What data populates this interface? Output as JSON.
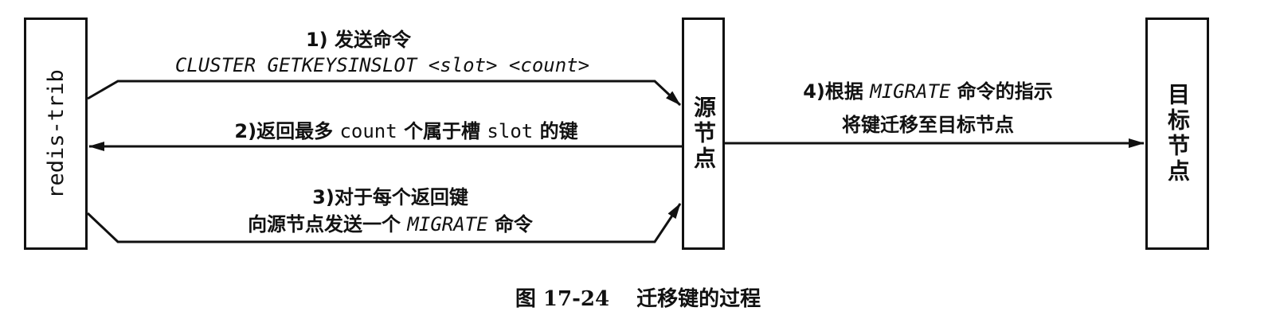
{
  "nodes": {
    "redis_trib": "redis-trib",
    "source": "源节点",
    "target": "目标节点"
  },
  "step1": {
    "title": "1) 发送命令",
    "command": "CLUSTER GETKEYSINSLOT <slot> <count>"
  },
  "step2": {
    "prefix": "2)返回最多",
    "count": "count",
    "middle": "个属于槽",
    "slot": "slot",
    "suffix": "的键"
  },
  "step3": {
    "title": "3)对于每个返回键",
    "prefix": "向源节点发送一个",
    "command": "MIGRATE",
    "suffix": "命令"
  },
  "step4": {
    "prefix": "4)根据",
    "command": "MIGRATE",
    "suffix": "命令的指示",
    "subtitle": "将键迁移至目标节点"
  },
  "caption": {
    "number": "图 17-24",
    "title": "迁移键的过程"
  },
  "colors": {
    "stroke": "#111111",
    "background": "#ffffff"
  }
}
